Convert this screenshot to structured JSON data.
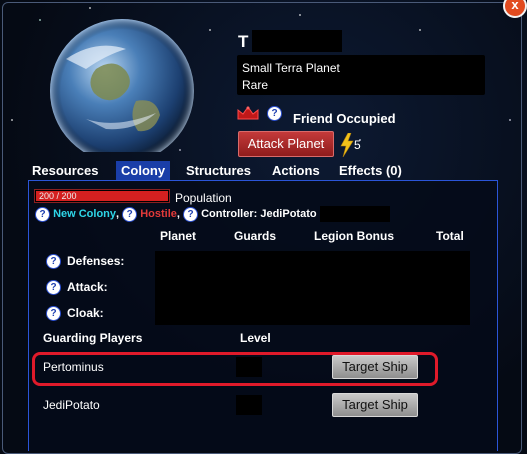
{
  "window": {
    "close_label": "x"
  },
  "planet": {
    "name": "T",
    "type": "Small Terra Planet",
    "rarity": "Rare",
    "occupation_status": "Friend Occupied",
    "attack_button": "Attack Planet",
    "energy_count": "5"
  },
  "tabs": [
    "Resources",
    "Colony",
    "Structures",
    "Actions",
    "Effects (0)"
  ],
  "active_tab": "Colony",
  "colony": {
    "population_text": "200 / 200",
    "population_fraction": 1.0,
    "population_label": "Population",
    "status_new_colony": "New Colony",
    "status_separator": ",",
    "status_hostile": "Hostile",
    "controller_label": "Controller: JediPotato"
  },
  "stats_table": {
    "headers": [
      "Planet",
      "Guards",
      "Legion Bonus",
      "Total"
    ],
    "rows": [
      {
        "label": "Defenses:"
      },
      {
        "label": "Attack:"
      },
      {
        "label": "Cloak:"
      }
    ]
  },
  "guards": {
    "header_players": "Guarding Players",
    "header_level": "Level",
    "button_label": "Target Ship",
    "rows": [
      {
        "name": "Pertominus"
      },
      {
        "name": "JediPotato"
      }
    ]
  },
  "colors": {
    "accent_blue": "#1a3ea8",
    "new_colony": "#2ed6e8",
    "hostile": "#e23a3a",
    "attack_red": "#c43a3a",
    "highlight": "#e01a2a"
  },
  "icons": {
    "crown": "crown-icon",
    "help": "help-icon",
    "energy": "lightning-bolt-icon",
    "close": "close-icon"
  }
}
